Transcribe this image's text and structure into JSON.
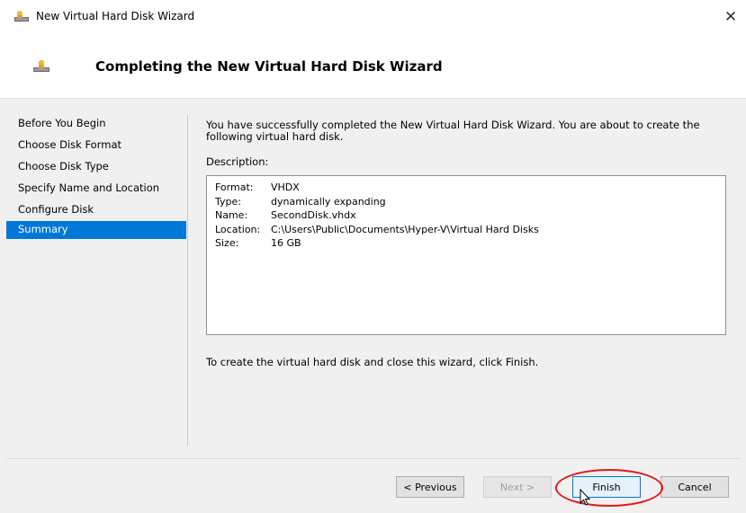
{
  "window": {
    "title": "New Virtual Hard Disk Wizard",
    "close_glyph": "✕",
    "icon": "wizard-disk-icon"
  },
  "header": {
    "title": "Completing the New Virtual Hard Disk Wizard",
    "icon": "wizard-disk-icon"
  },
  "nav": {
    "items": [
      {
        "label": "Before You Begin",
        "active": false
      },
      {
        "label": "Choose Disk Format",
        "active": false
      },
      {
        "label": "Choose Disk Type",
        "active": false
      },
      {
        "label": "Specify Name and Location",
        "active": false
      },
      {
        "label": "Configure Disk",
        "active": false
      },
      {
        "label": "Summary",
        "active": true
      }
    ],
    "active_color": "#0078d7"
  },
  "content": {
    "intro": "You have successfully completed the New Virtual Hard Disk Wizard. You are about to create the following virtual hard disk.",
    "description_label": "Description:",
    "summary": [
      {
        "key": "Format:",
        "value": "VHDX"
      },
      {
        "key": "Type:",
        "value": "dynamically expanding"
      },
      {
        "key": "Name:",
        "value": "SecondDisk.vhdx"
      },
      {
        "key": "Location:",
        "value": "C:\\Users\\Public\\Documents\\Hyper-V\\Virtual Hard Disks"
      },
      {
        "key": "Size:",
        "value": "16 GB"
      }
    ],
    "outro": "To create the virtual hard disk and close this wizard, click Finish."
  },
  "buttons": {
    "previous": "< Previous",
    "next": "Next >",
    "finish": "Finish",
    "cancel": "Cancel"
  },
  "annotation": {
    "highlight_color": "#e0181b"
  }
}
